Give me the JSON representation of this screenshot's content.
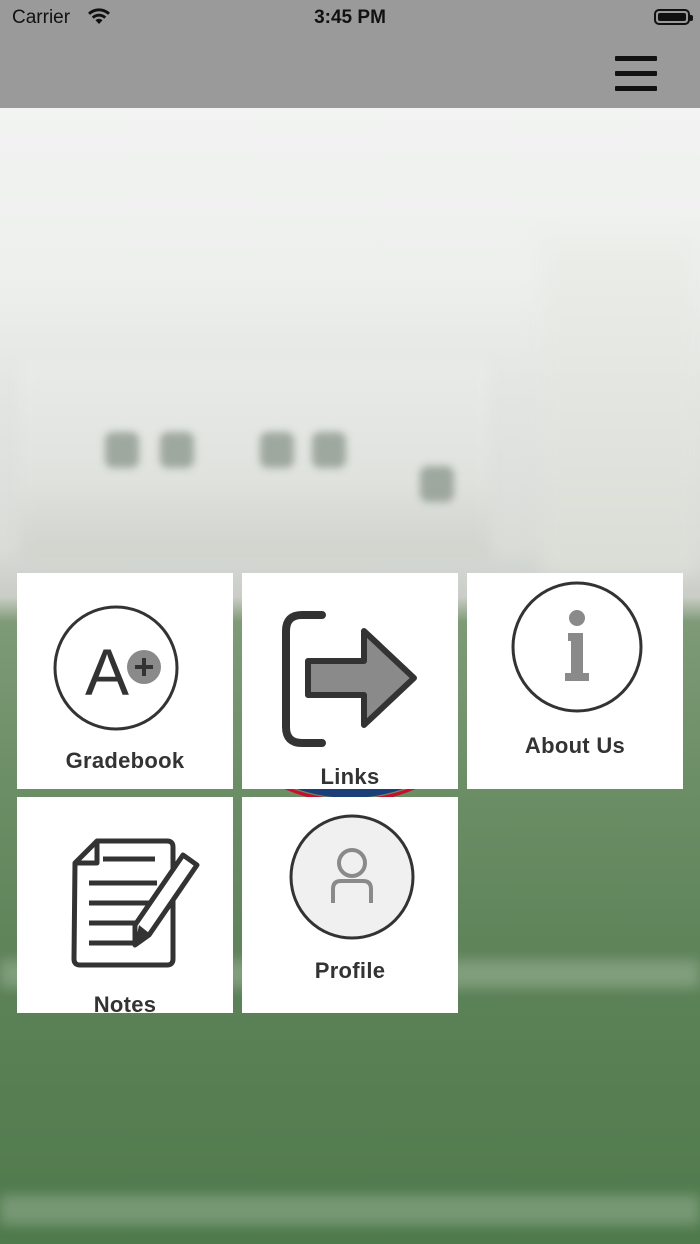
{
  "status_bar": {
    "carrier": "Carrier",
    "time": "3:45 PM"
  },
  "nav": {
    "menu_icon": "hamburger-menu-icon"
  },
  "tiles": [
    {
      "label": "Gradebook",
      "icon": "grade-a-plus-icon"
    },
    {
      "label": "Links",
      "icon": "exit-arrow-icon"
    },
    {
      "label": "About Us",
      "icon": "info-icon"
    },
    {
      "label": "Notes",
      "icon": "notes-pencil-icon"
    },
    {
      "label": "Profile",
      "icon": "user-profile-icon"
    }
  ],
  "grade_icon_text": "A",
  "colors": {
    "bars": "#9a9a9a",
    "tile": "#ffffff",
    "icon_stroke": "#333333",
    "icon_fill_gray": "#8a8a8a"
  }
}
